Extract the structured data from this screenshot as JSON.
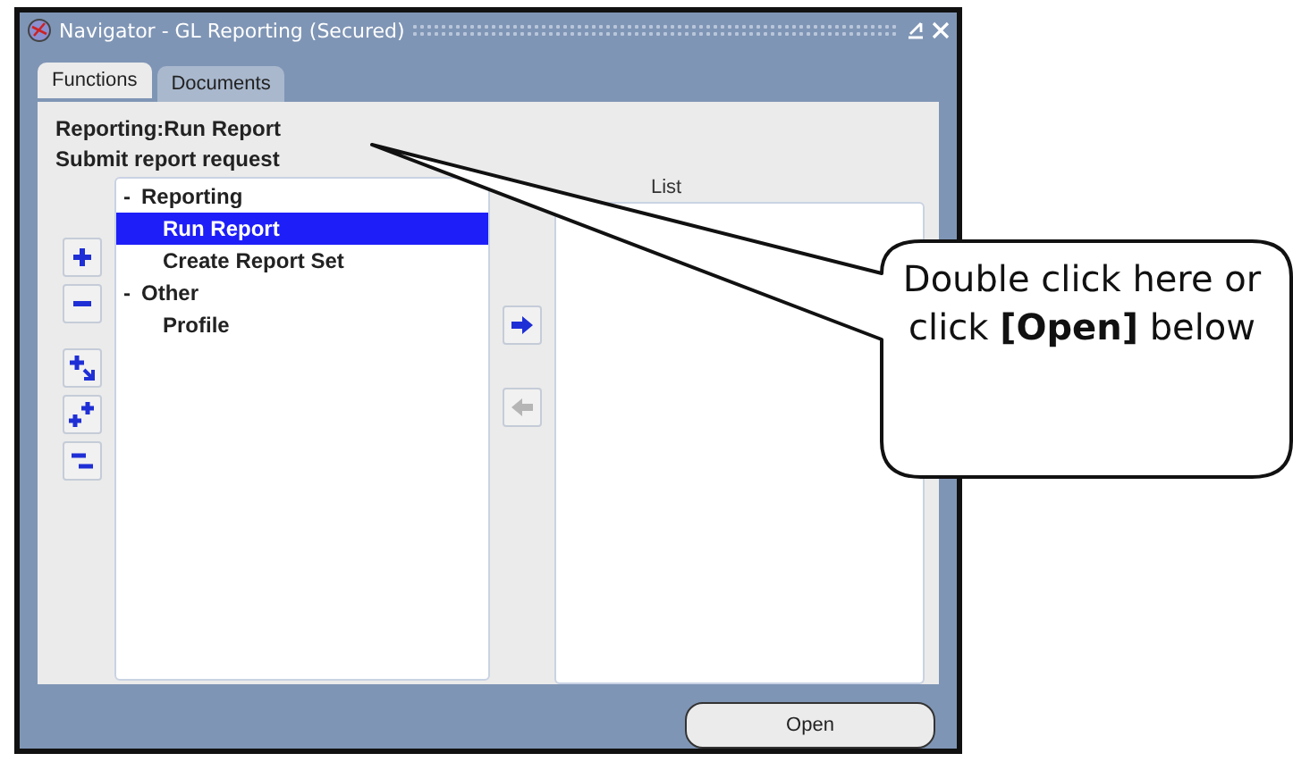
{
  "window": {
    "title": "Navigator - GL Reporting (Secured)"
  },
  "tabs": [
    {
      "label": "Functions",
      "selected": true
    },
    {
      "label": "Documents",
      "selected": false
    }
  ],
  "heading": "Reporting:Run Report",
  "description": "Submit report request",
  "tree": [
    {
      "marker": "-",
      "label": "Reporting",
      "selected": false,
      "children": [
        {
          "label": "Run Report",
          "selected": true
        },
        {
          "label": "Create Report Set",
          "selected": false
        }
      ]
    },
    {
      "marker": "-",
      "label": "Other",
      "selected": false,
      "children": [
        {
          "label": "Profile",
          "selected": false
        }
      ]
    }
  ],
  "tree_tools": [
    {
      "kind": "expand"
    },
    {
      "kind": "collapse"
    },
    {
      "kind": "expand-branch"
    },
    {
      "kind": "expand-all"
    },
    {
      "kind": "collapse-all"
    }
  ],
  "transfer_buttons": [
    {
      "kind": "add",
      "disabled": false
    },
    {
      "kind": "remove",
      "disabled": true
    }
  ],
  "list_label": "List",
  "buttons": [
    {
      "label": "Open"
    }
  ],
  "callout": {
    "text": "Double click here or click **[Open]** below"
  }
}
